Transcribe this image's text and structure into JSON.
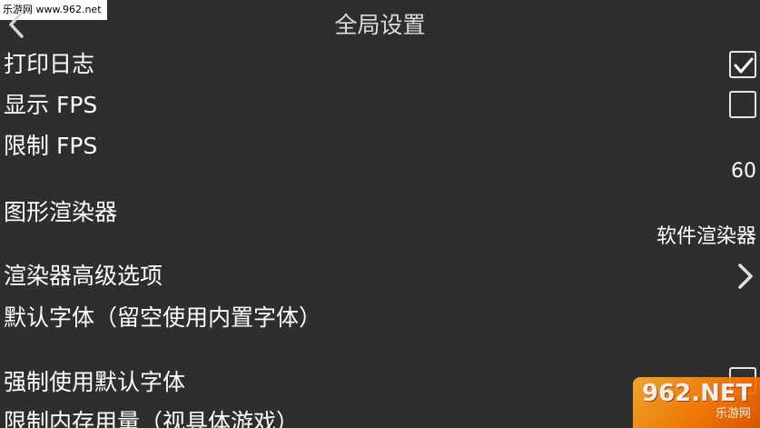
{
  "header": {
    "title": "全局设置",
    "back_icon": "chevron-left-icon"
  },
  "watermarks": {
    "top_text": "乐游网 www.962.net",
    "bottom_logo": "962.NET",
    "bottom_sub": "乐游网"
  },
  "settings": {
    "print_log": {
      "label": "打印日志",
      "checked": true
    },
    "show_fps": {
      "label": "显示 FPS",
      "checked": false
    },
    "limit_fps": {
      "label": "限制 FPS",
      "value": "60"
    },
    "renderer": {
      "label": "图形渲染器",
      "value": "软件渲染器"
    },
    "renderer_advanced": {
      "label": "渲染器高级选项",
      "icon": "chevron-right-icon"
    },
    "default_font": {
      "label": "默认字体（留空使用内置字体）"
    },
    "force_default_font": {
      "label": "强制使用默认字体",
      "checked": false
    },
    "memory_limit": {
      "label": "限制内存用量（视具体游戏）"
    }
  },
  "colors": {
    "background": "#2e2e2e",
    "text": "#ffffff",
    "title": "#dcdcdc",
    "watermark_orange": "#ff7a00"
  }
}
